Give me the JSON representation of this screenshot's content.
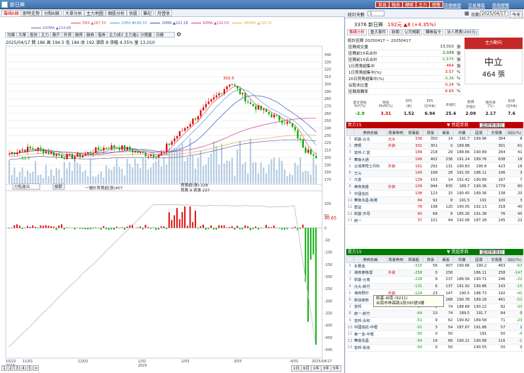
{
  "window": {
    "title": "新日興",
    "buttons": [
      "首頁",
      "報表",
      "轉帳",
      "主力",
      "總覽"
    ],
    "links": [
      "註冊帳號",
      "交易專區",
      "券商總覽"
    ]
  },
  "tabs": [
    "籌碼K線",
    "即時走勢",
    "分點K線",
    "大單分析",
    "主力地圖",
    "個股分析",
    "估股",
    "筆記",
    "月營收"
  ],
  "toolbar": [
    "均線",
    "大單",
    "投信",
    "主力",
    "散戶",
    "外資",
    "融資",
    "融券",
    "借券",
    "主力成本",
    "主力進出",
    "分價量",
    "日線"
  ],
  "ma_legend": [
    {
      "label": "5MA ▲187.50",
      "color": "#e05050"
    },
    {
      "label": "10MA ▼186.50",
      "color": "#4a9fd8"
    },
    {
      "label": "20MA ▲221.18",
      "color": "#4050c0"
    },
    {
      "label": "60MA ▲216.03",
      "color": "#d04080"
    },
    {
      "label": "480MA ▲194.31",
      "color": "#e0b050"
    }
  ],
  "ma200": "200MA ▲214.68",
  "quote_line1": "2025/04/17  開 186  高 194.5  低 184  收 192  漲跌 8  漲幅 4.35%  量 13,010",
  "toggle_label": "分散筆觸",
  "price_axis": [
    "340",
    "330",
    "320",
    "310",
    "300",
    "290",
    "280",
    "270",
    "260",
    "250",
    "240",
    "230",
    "220",
    "210",
    "200",
    "190",
    "180",
    "170"
  ],
  "high_label": "302.5",
  "low_label": "33.5",
  "sub_indicator": {
    "select": "分點進出",
    "button": "細節",
    "label1": "一讀計買賣超(張)407",
    "label2": "買賣超(張)-228",
    "label3": "買賣 9 資張 237"
  },
  "sub_axis": [
    "100",
    "50",
    "0",
    "-50",
    "-100",
    "-150",
    "-200",
    "-250",
    "-300",
    "-350",
    "-400",
    "-450",
    "-500"
  ],
  "sub_value": "40.65",
  "x_axis": [
    "10/22\n2024",
    "11/01",
    "12/02",
    "1/02\n2025",
    "2/03",
    "3/03",
    "4/01",
    "2025/04/17"
  ],
  "pager": [
    "1",
    "2",
    "3",
    "4",
    "5"
  ],
  "ranges": [
    "1日",
    "6月",
    "1年",
    "3年",
    "5年"
  ],
  "right": {
    "period_label": "統計天數",
    "period_value": "1",
    "date_label": "日期",
    "date_value": "2025/04/17",
    "today": "今天",
    "stock_line": "3376 新日興",
    "price": "192元",
    "change": "▲8 (+4.35%)",
    "rp_tabs": [
      "籌碼分析",
      "重大事件",
      "新聞",
      "公司規範",
      "轉帳指令",
      "法人買賣(200元)"
    ],
    "range_label": "統計區間  20250417 ~ 20250417",
    "stats": [
      {
        "k": "區間成交量",
        "v": "13,010",
        "u": "張"
      },
      {
        "k": "區間前15名合計",
        "v": "2,039",
        "u": "張"
      },
      {
        "k": "區間前15名合計",
        "v": "-1,575",
        "u": "張"
      },
      {
        "k": "1日買賣超集中",
        "v": "464",
        "u": "張"
      },
      {
        "k": "1日買賣超集中(%)",
        "v": "3.57",
        "u": "%"
      },
      {
        "k": "20日買賣超集中(%)",
        "v": "-3.26",
        "u": "%"
      },
      {
        "k": "佔股本比重",
        "v": "0.24",
        "u": "%"
      },
      {
        "k": "區間周轉率",
        "v": "6.65",
        "u": "%"
      }
    ],
    "badge_head": "主力動向",
    "badge_title": "中立",
    "badge_value": "464 張",
    "fin_heads": [
      "累計營收\nYoY(%)",
      "營收\nMoM(%)",
      "EPS\n(季)",
      "EPS\n(近4季)",
      "本益比",
      "股價\n淨值比",
      "殖利率\n(%)",
      "ROE\n(近4季)"
    ],
    "fin_vals": [
      "-2.9",
      "3.31",
      "1.52",
      "6.94",
      "25.4",
      "2.09",
      "2.17",
      "7.6"
    ],
    "buy_title": "買方15",
    "sell_title": "賣方15",
    "broker_heads": [
      "",
      "券商名稱",
      "買賣券商",
      "買賣超",
      "買張",
      "賣張",
      "均價",
      "區間",
      "交易量",
      "佔比(%)"
    ],
    "buy_rows": [
      [
        "1",
        "凱基-台北",
        "元大",
        "336",
        "350",
        "14",
        "191.7",
        "189.96",
        "364",
        "8"
      ],
      [
        "2",
        "摩根",
        "外資",
        "301",
        "301",
        "0",
        "189.88",
        "",
        "301",
        "61"
      ],
      [
        "3",
        "富邦-仁愛",
        "",
        "189",
        "218",
        "29",
        "188.66",
        "190.89",
        "264",
        "41"
      ],
      [
        "4",
        "華南大通",
        "",
        "166",
        "402",
        "236",
        "191.14",
        "189.76",
        "638",
        "18"
      ],
      [
        "5",
        "台灣摩根士丹利",
        "外資",
        "161",
        "292",
        "131",
        "190.83",
        "190.8",
        "423",
        "18"
      ],
      [
        "6",
        "王山",
        "",
        "140",
        "168",
        "28",
        "191.05",
        "188.11",
        "196",
        "3"
      ],
      [
        "7",
        "元富",
        "",
        "139",
        "153",
        "14",
        "191.42",
        "190.89",
        "167",
        "7"
      ],
      [
        "8",
        "美商高盛",
        "外資",
        "109",
        "944",
        "835",
        "189.7",
        "190.36",
        "1779",
        "80"
      ],
      [
        "9",
        "中國信託",
        "",
        "108",
        "123",
        "15",
        "190.45",
        "189.36",
        "138",
        "20"
      ],
      [
        "10",
        "華南永昌-板橋",
        "",
        "84",
        "92",
        "8",
        "191.5",
        "191",
        "100",
        "3"
      ],
      [
        "11",
        "群益",
        "",
        "78",
        "198",
        "120",
        "190.05",
        "192.13",
        "318",
        "40"
      ],
      [
        "12",
        "凱基-天母",
        "",
        "60",
        "68",
        "8",
        "185.26",
        "191.38",
        "76",
        "45"
      ],
      [
        "13",
        "統一",
        "",
        "37",
        "101",
        "44",
        "192.06",
        "187.28",
        "145",
        "22"
      ]
    ],
    "sell_rows": [
      [
        "1",
        "永豐金",
        "",
        "-315",
        "56",
        "407",
        "190.66",
        "190.2",
        "463",
        "-63"
      ],
      [
        "2",
        "港商麥格理",
        "外資",
        "-258",
        "0",
        "258",
        "",
        "186.11",
        "258",
        "-147"
      ],
      [
        "3",
        "凱基-台南",
        "",
        "-228",
        "9",
        "237",
        "186.56",
        "190.71",
        "246",
        "-22"
      ],
      [
        "4",
        "元大-新竹",
        "",
        "-131",
        "6",
        "137",
        "191.92",
        "190.86",
        "143",
        "-15"
      ],
      [
        "5",
        "港商野村",
        "外資",
        "-124",
        "23",
        "147",
        "190.5",
        "188.73",
        "192",
        "-41"
      ],
      [
        "6",
        "新加坡商",
        "外資",
        "-117",
        "151",
        "268",
        "190.78",
        "189.18",
        "461",
        "-51"
      ],
      [
        "7",
        "富邦",
        "",
        "-84",
        "8",
        "74",
        "188.68",
        "190.22",
        "82",
        "-33"
      ],
      [
        "8",
        "統一-新竹",
        "",
        "-64",
        "10",
        "74",
        "189.5",
        "191.7",
        "84",
        "0"
      ],
      [
        "9",
        "富邦-永和",
        "",
        "-51",
        "9",
        "62",
        "190.82",
        "189.58",
        "71",
        "-23"
      ],
      [
        "10",
        "中國信託-中壢",
        "",
        "-51",
        "3",
        "54",
        "187.67",
        "191.88",
        "57",
        "1"
      ],
      [
        "11",
        "第一金-中壢",
        "",
        "-50",
        "0",
        "50",
        "",
        "191",
        "50",
        "-4"
      ],
      [
        "12",
        "華南永昌",
        "",
        "-50",
        "16",
        "66",
        "190.21",
        "190.98",
        "116",
        "-1"
      ],
      [
        "13",
        "富邦-板信",
        "",
        "-50",
        "0",
        "50",
        "",
        "190.55",
        "50",
        "0"
      ]
    ],
    "select_label": "區間買賣超",
    "buy_badge": "▼ 買超券商",
    "sell_badge": "▼ 賣超券商"
  },
  "tooltip": {
    "line1": "凱基-台南 (9211)",
    "line2": "台南市林森路1段395號3樓"
  },
  "colors": {
    "up": "#d00000",
    "down": "#00a000",
    "buyHeader": "#c00000",
    "sellHeader": "#007a00"
  }
}
